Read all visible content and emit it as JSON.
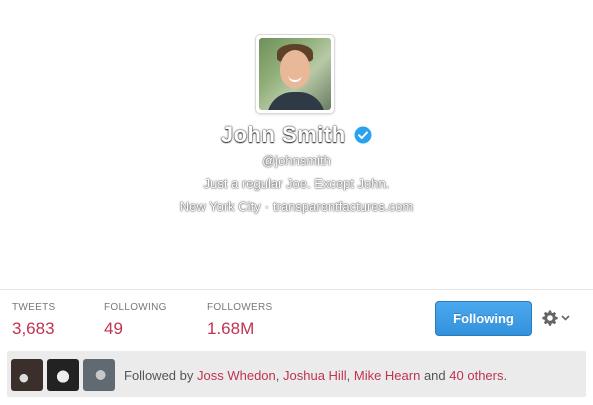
{
  "profile": {
    "name": "John Smith",
    "handle": "@johnsmith",
    "bio": "Just a regular Joe. Except John.",
    "location": "New York City",
    "separator": "·",
    "website": "transparentfactures.com"
  },
  "stats": {
    "tweets_label": "TWEETS",
    "tweets_value": "3,683",
    "following_label": "FOLLOWING",
    "following_value": "49",
    "followers_label": "FOLLOWERS",
    "followers_value": "1.68M"
  },
  "actions": {
    "follow_label": "Following"
  },
  "followed_by": {
    "prefix": "Followed by",
    "user1": "Joss Whedon",
    "comma1": ",",
    "user2": "Joshua Hill",
    "comma2": ",",
    "user3": "Mike Hearn",
    "and": "and",
    "others": "40 others",
    "period": "."
  },
  "colors": {
    "accent": "#c0334f",
    "button": "#3a9ae6",
    "verified": "#2aa3ef"
  },
  "icons": [
    "verified-badge-icon",
    "gear-icon",
    "caret-down-icon"
  ]
}
